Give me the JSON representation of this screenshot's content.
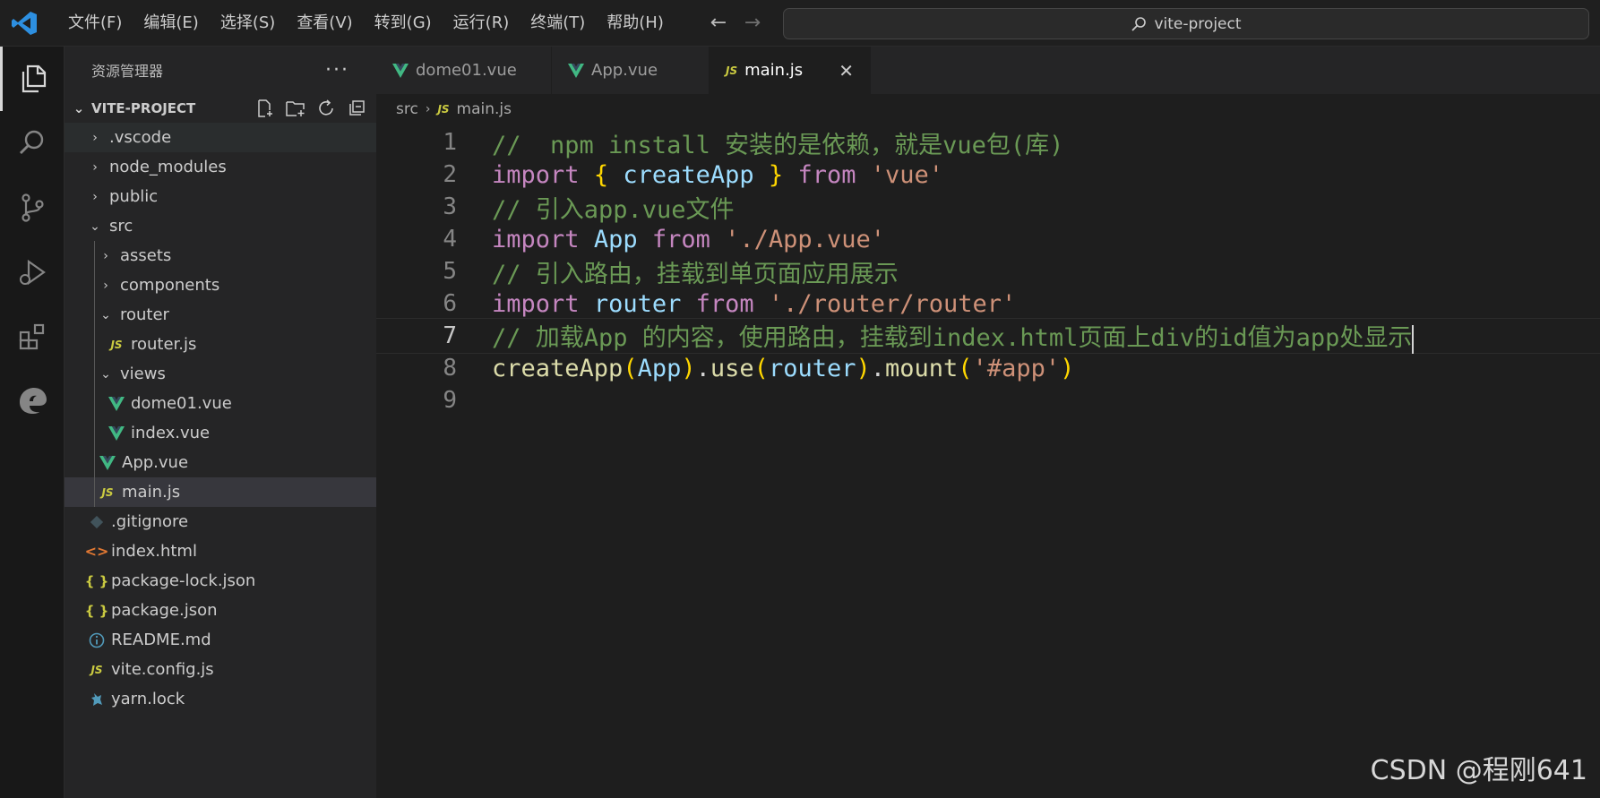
{
  "menu": [
    "文件(F)",
    "编辑(E)",
    "选择(S)",
    "查看(V)",
    "转到(G)",
    "运行(R)",
    "终端(T)",
    "帮助(H)"
  ],
  "command_center": {
    "text": "vite-project"
  },
  "sidebar": {
    "title": "资源管理器",
    "project": "VITE-PROJECT",
    "tree": [
      {
        "label": ".vscode",
        "type": "folder",
        "expanded": false
      },
      {
        "label": "node_modules",
        "type": "folder",
        "expanded": false
      },
      {
        "label": "public",
        "type": "folder",
        "expanded": false
      },
      {
        "label": "src",
        "type": "folder",
        "expanded": true
      },
      {
        "label": "assets",
        "type": "folder",
        "expanded": false
      },
      {
        "label": "components",
        "type": "folder",
        "expanded": false
      },
      {
        "label": "router",
        "type": "folder",
        "expanded": true
      },
      {
        "label": "router.js",
        "type": "js"
      },
      {
        "label": "views",
        "type": "folder",
        "expanded": true
      },
      {
        "label": "dome01.vue",
        "type": "vue"
      },
      {
        "label": "index.vue",
        "type": "vue"
      },
      {
        "label": "App.vue",
        "type": "vue"
      },
      {
        "label": "main.js",
        "type": "js",
        "selected": true
      },
      {
        "label": ".gitignore",
        "type": "git"
      },
      {
        "label": "index.html",
        "type": "html"
      },
      {
        "label": "package-lock.json",
        "type": "json"
      },
      {
        "label": "package.json",
        "type": "json"
      },
      {
        "label": "README.md",
        "type": "info"
      },
      {
        "label": "vite.config.js",
        "type": "js"
      },
      {
        "label": "yarn.lock",
        "type": "yarn"
      }
    ]
  },
  "tabs": [
    {
      "label": "dome01.vue",
      "icon": "vue-icon",
      "active": false
    },
    {
      "label": "App.vue",
      "icon": "vue-icon",
      "active": false
    },
    {
      "label": "main.js",
      "icon": "js-icon",
      "active": true
    }
  ],
  "breadcrumb": {
    "folder": "src",
    "file": "main.js"
  },
  "editor": {
    "line_numbers": [
      "1",
      "2",
      "3",
      "4",
      "5",
      "6",
      "7",
      "8",
      "9"
    ],
    "current_line": 7,
    "lines": [
      "//  npm install 安装的是依赖，就是vue包(库)",
      "import { createApp } from 'vue'",
      "// 引入app.vue文件",
      "import App from './App.vue'",
      "// 引入路由，挂载到单页面应用展示",
      "import router from './router/router'",
      "// 加载App 的内容，使用路由，挂载到index.html页面上div的id值为app处显示",
      "createApp(App).use(router).mount('#app')",
      ""
    ]
  },
  "icons": {
    "js_badge": "JS",
    "json_badge": "{ }",
    "html_badge": "<>"
  },
  "watermark": "CSDN @程刚641",
  "colors": {
    "vue_green": "#41b883",
    "js_yellow": "#cbcb41",
    "comment": "#6a9955",
    "keyword": "#c586c0",
    "string": "#ce9178"
  }
}
